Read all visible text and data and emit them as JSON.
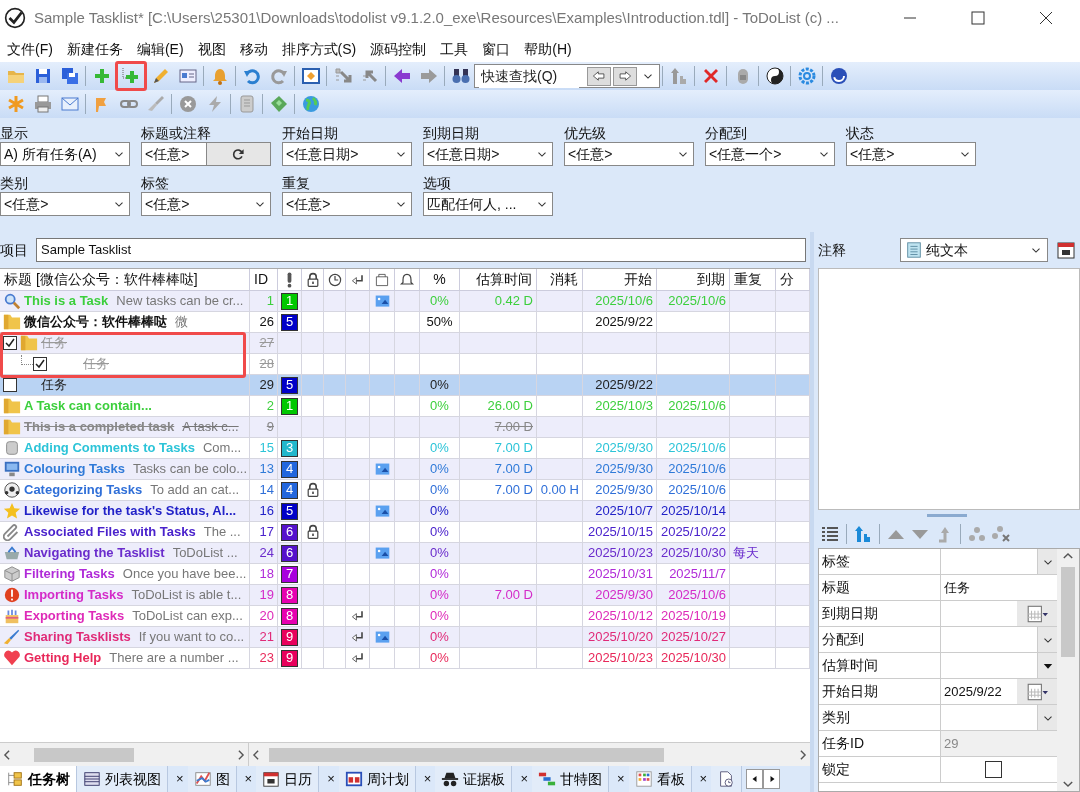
{
  "window": {
    "title": "Sample Tasklist* [C:\\Users\\25301\\Downloads\\todolist  v9.1.2.0_exe\\Resources\\Examples\\Introduction.tdl] - ToDoList (c) ..."
  },
  "menu": [
    "文件(F)",
    "新建任务",
    "编辑(E)",
    "视图",
    "移动",
    "排序方式(S)",
    "源码控制",
    "工具",
    "窗口",
    "帮助(H)"
  ],
  "toolbar1": [
    {
      "kind": "open"
    },
    {
      "kind": "save"
    },
    {
      "kind": "saveall"
    },
    {
      "kind": "sep"
    },
    {
      "kind": "add"
    },
    {
      "kind": "addsub",
      "highlighted": true
    },
    {
      "kind": "edit"
    },
    {
      "kind": "card"
    },
    {
      "kind": "sep"
    },
    {
      "kind": "bell"
    },
    {
      "kind": "sep"
    },
    {
      "kind": "undo"
    },
    {
      "kind": "redo"
    },
    {
      "kind": "sep"
    },
    {
      "kind": "maximize"
    },
    {
      "kind": "sep"
    },
    {
      "kind": "moveright"
    },
    {
      "kind": "moveleft"
    },
    {
      "kind": "sep"
    },
    {
      "kind": "left"
    },
    {
      "kind": "right"
    },
    {
      "kind": "sep"
    },
    {
      "kind": "find"
    },
    {
      "kind": "quickfind",
      "placeholder": "快速查找(Q)"
    },
    {
      "kind": "sep"
    },
    {
      "kind": "sortup"
    },
    {
      "kind": "sep"
    },
    {
      "kind": "delete"
    },
    {
      "kind": "sep"
    },
    {
      "kind": "lock"
    },
    {
      "kind": "sep"
    },
    {
      "kind": "yinyang"
    },
    {
      "kind": "sep"
    },
    {
      "kind": "gear"
    },
    {
      "kind": "sep"
    },
    {
      "kind": "help"
    }
  ],
  "toolbar2": [
    {
      "kind": "asterisk"
    },
    {
      "kind": "print"
    },
    {
      "kind": "mail"
    },
    {
      "kind": "sep"
    },
    {
      "kind": "flag"
    },
    {
      "kind": "link"
    },
    {
      "kind": "brush"
    },
    {
      "kind": "sep"
    },
    {
      "kind": "cancel"
    },
    {
      "kind": "bolt"
    },
    {
      "kind": "sep"
    },
    {
      "kind": "scroll"
    },
    {
      "kind": "sep"
    },
    {
      "kind": "ticket"
    },
    {
      "kind": "sep"
    },
    {
      "kind": "globe"
    }
  ],
  "filters": [
    {
      "label": "显示",
      "value": "A) 所有任务(A)",
      "kind": "dropdown"
    },
    {
      "label": "标题或注释",
      "value": "<任意>",
      "kind": "search"
    },
    {
      "label": "开始日期",
      "value": "<任意日期>",
      "kind": "dropdown"
    },
    {
      "label": "到期日期",
      "value": "<任意日期>",
      "kind": "dropdown"
    },
    {
      "label": "优先级",
      "value": "<任意>",
      "kind": "dropdown"
    },
    {
      "label": "分配到",
      "value": "<任意一个>",
      "kind": "dropdown"
    },
    {
      "label": "状态",
      "value": "<任意>",
      "kind": "dropdown"
    },
    {
      "label": "类别",
      "value": "<任意>",
      "kind": "dropdown"
    },
    {
      "label": "标签",
      "value": "<任意>",
      "kind": "dropdown"
    },
    {
      "label": "重复",
      "value": "<任意>",
      "kind": "dropdown"
    },
    {
      "label": "选项",
      "value": "匹配任何人, ...",
      "kind": "dropdown"
    }
  ],
  "project": {
    "label": "项目",
    "value": "Sample Tasklist"
  },
  "columns": [
    {
      "kind": "text",
      "label": "标题 [微信公众号：软件棒棒哒]"
    },
    {
      "kind": "text",
      "label": "ID"
    },
    {
      "kind": "icon"
    },
    {
      "kind": "icon"
    },
    {
      "kind": "icon"
    },
    {
      "kind": "icon"
    },
    {
      "kind": "icon"
    },
    {
      "kind": "icon"
    },
    {
      "kind": "text",
      "label": "%"
    },
    {
      "kind": "text",
      "label": "估算时间"
    },
    {
      "kind": "text",
      "label": "消耗"
    },
    {
      "kind": "text",
      "label": "开始"
    },
    {
      "kind": "text",
      "label": "到期"
    },
    {
      "kind": "text",
      "label": "重复"
    },
    {
      "kind": "text",
      "label": "分"
    }
  ],
  "tasks": [
    {
      "title": "This is a Task",
      "note": "New tasks can be cr...",
      "id": "1",
      "priority": {
        "label": "1",
        "color": "#00c800"
      },
      "color": "#3ccf3c",
      "bold": true,
      "has_file": true,
      "percent": "0%",
      "estimate": "0.42 D",
      "start": "2025/10/6",
      "due": "2025/10/6",
      "done": false,
      "selected": false
    },
    {
      "title": "微信公众号：软件棒棒哒",
      "note": "微",
      "id": "26",
      "priority": {
        "label": "5",
        "color": "#0000c8"
      },
      "color": "#111111",
      "bold": true,
      "percent": "50%",
      "start": "2025/9/22",
      "done": false,
      "selected": false
    },
    {
      "title": "任务",
      "id": "27",
      "color": "#999999",
      "bold": false,
      "checked": true,
      "highlighted": true,
      "done": true,
      "selected": false,
      "children": [
        {
          "title": "任务",
          "id": "28",
          "color": "#999999",
          "bold": false,
          "checked": true,
          "highlighted": true,
          "done": true,
          "selected": false
        }
      ]
    },
    {
      "title": "任务",
      "id": "29",
      "priority": {
        "label": "5",
        "color": "#0000c8"
      },
      "color": "#222222",
      "bold": false,
      "checked": false,
      "percent": "0%",
      "start": "2025/9/22",
      "done": false,
      "selected": true
    },
    {
      "title": "A Task can contain...",
      "id": "2",
      "priority": {
        "label": "1",
        "color": "#00c800"
      },
      "color": "#3ccf3c",
      "bold": true,
      "percent": "0%",
      "estimate": "26.00 D",
      "start": "2025/10/3",
      "due": "2025/10/6",
      "done": false,
      "selected": false
    },
    {
      "title": "This is a completed task",
      "note": "A task c...",
      "id": "9",
      "color": "#888888",
      "bold": true,
      "estimate": "7.00 D",
      "done": true,
      "selected": false
    },
    {
      "title": "Adding Comments to Tasks",
      "note": "Com...",
      "id": "15",
      "priority": {
        "label": "3",
        "color": "#22b8cc"
      },
      "color": "#2cc4d8",
      "bold": true,
      "percent": "0%",
      "estimate": "7.00 D",
      "start": "2025/9/30",
      "due": "2025/10/6",
      "done": false,
      "selected": false
    },
    {
      "title": "Colouring Tasks",
      "note": "Tasks can be colo...",
      "id": "13",
      "priority": {
        "label": "4",
        "color": "#2266dd"
      },
      "color": "#2f7ad8",
      "bold": true,
      "has_file": true,
      "percent": "0%",
      "estimate": "7.00 D",
      "start": "2025/9/30",
      "due": "2025/10/6",
      "done": false,
      "selected": false
    },
    {
      "title": "Categorizing Tasks",
      "note": "To add an cat...",
      "id": "14",
      "priority": {
        "label": "4",
        "color": "#2266dd"
      },
      "color": "#2f6fd8",
      "bold": true,
      "locked": true,
      "percent": "0%",
      "estimate": "7.00 D",
      "spent": "0.00 H",
      "start": "2025/9/30",
      "due": "2025/10/6",
      "done": false,
      "selected": false
    },
    {
      "title": "Likewise for the task's Status, Al...",
      "id": "16",
      "priority": {
        "label": "5",
        "color": "#0000c8"
      },
      "color": "#2222c8",
      "bold": true,
      "has_file": true,
      "percent": "0%",
      "start": "2025/10/7",
      "due": "2025/10/14",
      "done": false,
      "selected": false
    },
    {
      "title": "Associated Files with Tasks",
      "note": "The ...",
      "id": "17",
      "priority": {
        "label": "6",
        "color": "#5511cc"
      },
      "color": "#4a22cc",
      "bold": true,
      "locked": true,
      "percent": "0%",
      "start": "2025/10/15",
      "due": "2025/10/22",
      "done": false,
      "selected": false
    },
    {
      "title": "Navigating the Tasklist",
      "note": "ToDoList ...",
      "id": "24",
      "priority": {
        "label": "6",
        "color": "#5511cc"
      },
      "color": "#6a2ccc",
      "bold": true,
      "has_file": true,
      "percent": "0%",
      "start": "2025/10/23",
      "due": "2025/10/30",
      "recurrence": "每天",
      "done": false,
      "selected": false
    },
    {
      "title": "Filtering Tasks",
      "note": "Once you have bee...",
      "id": "18",
      "priority": {
        "label": "7",
        "color": "#a800dd"
      },
      "color": "#b02ad8",
      "bold": true,
      "percent": "0%",
      "start": "2025/10/31",
      "due": "2025/11/7",
      "done": false,
      "selected": false
    },
    {
      "title": "Importing Tasks",
      "note": "ToDoList is able t...",
      "id": "19",
      "priority": {
        "label": "8",
        "color": "#e600b0"
      },
      "color": "#d42ac8",
      "bold": true,
      "percent": "0%",
      "estimate": "7.00 D",
      "start": "2025/9/30",
      "due": "2025/10/6",
      "done": false,
      "selected": false
    },
    {
      "title": "Exporting Tasks",
      "note": "ToDoList can exp...",
      "id": "20",
      "priority": {
        "label": "8",
        "color": "#e600b0"
      },
      "color": "#de2ab8",
      "bold": true,
      "recurring": true,
      "percent": "0%",
      "start": "2025/10/12",
      "due": "2025/10/19",
      "done": false,
      "selected": false
    },
    {
      "title": "Sharing Tasklists",
      "note": "If you want to co...",
      "id": "21",
      "priority": {
        "label": "9",
        "color": "#e8005c"
      },
      "color": "#e02a78",
      "bold": true,
      "recurring": true,
      "has_file": true,
      "percent": "0%",
      "start": "2025/10/20",
      "due": "2025/10/27",
      "done": false,
      "selected": false
    },
    {
      "title": "Getting Help",
      "note": "There are a number ...",
      "id": "23",
      "priority": {
        "label": "9",
        "color": "#e8005c"
      },
      "color": "#e8285a",
      "bold": true,
      "recurring": true,
      "percent": "0%",
      "start": "2025/10/23",
      "due": "2025/10/30",
      "done": false,
      "selected": false
    }
  ],
  "view_tabs": [
    {
      "label": "任务树",
      "selected": true,
      "closable": false
    },
    {
      "label": "列表视图",
      "selected": false,
      "closable": true
    },
    {
      "label": "图",
      "selected": false,
      "closable": true
    },
    {
      "label": "日历",
      "selected": false,
      "closable": true
    },
    {
      "label": "周计划",
      "selected": false,
      "closable": true
    },
    {
      "label": "证据板",
      "selected": false,
      "closable": true
    },
    {
      "label": "甘特图",
      "selected": false,
      "closable": true
    },
    {
      "label": "看板",
      "selected": false,
      "closable": true
    },
    {
      "selected": false,
      "closable": false
    }
  ],
  "tab_close_label": "×",
  "comments": {
    "label": "注释",
    "format": "纯文本"
  },
  "properties": [
    {
      "label": "标签",
      "kind": "dropdown"
    },
    {
      "label": "标题",
      "value": "任务",
      "kind": "text"
    },
    {
      "label": "到期日期",
      "kind": "date"
    },
    {
      "label": "分配到",
      "kind": "dropdown"
    },
    {
      "label": "估算时间",
      "kind": "spin"
    },
    {
      "label": "开始日期",
      "value": "2025/9/22",
      "kind": "date"
    },
    {
      "label": "类别",
      "kind": "dropdown"
    },
    {
      "label": "任务ID",
      "value": "29",
      "kind": "readonly"
    },
    {
      "label": "锁定",
      "kind": "checkbox",
      "checked": false
    }
  ]
}
